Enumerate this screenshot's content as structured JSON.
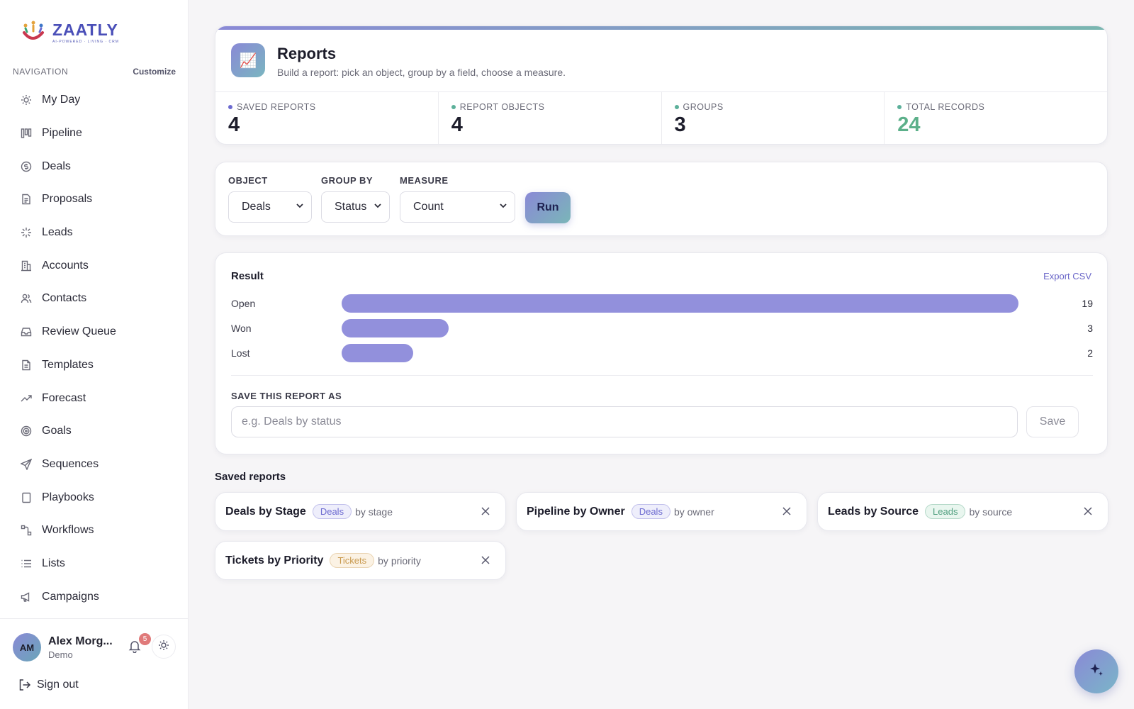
{
  "brand": {
    "name": "ZAATLY",
    "tagline": "AI-POWERED · LIVING · CRM"
  },
  "nav": {
    "header": "NAVIGATION",
    "customize": "Customize",
    "items": [
      {
        "label": "My Day",
        "icon": "sun-icon"
      },
      {
        "label": "Pipeline",
        "icon": "pipeline-icon"
      },
      {
        "label": "Deals",
        "icon": "dollar-icon"
      },
      {
        "label": "Proposals",
        "icon": "document-icon"
      },
      {
        "label": "Leads",
        "icon": "sparkle-icon"
      },
      {
        "label": "Accounts",
        "icon": "building-icon"
      },
      {
        "label": "Contacts",
        "icon": "users-icon"
      },
      {
        "label": "Review Queue",
        "icon": "inbox-icon"
      },
      {
        "label": "Templates",
        "icon": "file-icon"
      },
      {
        "label": "Forecast",
        "icon": "trend-icon"
      },
      {
        "label": "Goals",
        "icon": "target-icon"
      },
      {
        "label": "Sequences",
        "icon": "send-icon"
      },
      {
        "label": "Playbooks",
        "icon": "book-icon"
      },
      {
        "label": "Workflows",
        "icon": "workflow-icon"
      },
      {
        "label": "Lists",
        "icon": "list-icon"
      },
      {
        "label": "Campaigns",
        "icon": "megaphone-icon"
      }
    ]
  },
  "user": {
    "initials": "AM",
    "name": "Alex Morg...",
    "role": "Demo",
    "notifications": "5",
    "signout": "Sign out"
  },
  "header": {
    "title": "Reports",
    "subtitle": "Build a report: pick an object, group by a field, choose a measure.",
    "icon": "📈",
    "stats": [
      {
        "label": "SAVED REPORTS",
        "value": "4",
        "color": "#6c6ad0",
        "value_color": "#1d1d2b"
      },
      {
        "label": "REPORT OBJECTS",
        "value": "4",
        "color": "#5cb09a",
        "value_color": "#1d1d2b"
      },
      {
        "label": "GROUPS",
        "value": "3",
        "color": "#5cb09a",
        "value_color": "#1d1d2b"
      },
      {
        "label": "TOTAL RECORDS",
        "value": "24",
        "color": "#5cb09a",
        "value_color": "#5cb08a"
      }
    ]
  },
  "builder": {
    "object_label": "OBJECT",
    "object_value": "Deals",
    "group_label": "GROUP BY",
    "group_value": "Status",
    "measure_label": "MEASURE",
    "measure_value": "Count",
    "run": "Run"
  },
  "result": {
    "title": "Result",
    "export": "Export CSV",
    "save_label": "SAVE THIS REPORT AS",
    "save_placeholder": "e.g. Deals by status",
    "save_button": "Save"
  },
  "chart_data": {
    "type": "bar",
    "categories": [
      "Open",
      "Won",
      "Lost"
    ],
    "values": [
      19,
      3,
      2
    ],
    "xlim": [
      0,
      19
    ]
  },
  "saved": {
    "title": "Saved reports",
    "items": [
      {
        "name": "Deals by Stage",
        "object": "Deals",
        "by": "by stage",
        "pill_color": "#6c6ad0",
        "pill_bg": "#eeeefb"
      },
      {
        "name": "Pipeline by Owner",
        "object": "Deals",
        "by": "by owner",
        "pill_color": "#6c6ad0",
        "pill_bg": "#eeeefb"
      },
      {
        "name": "Leads by Source",
        "object": "Leads",
        "by": "by source",
        "pill_color": "#4f9e7e",
        "pill_bg": "#e9f6ef"
      },
      {
        "name": "Tickets by Priority",
        "object": "Tickets",
        "by": "by priority",
        "pill_color": "#c99a4f",
        "pill_bg": "#fbf2e4"
      }
    ]
  }
}
